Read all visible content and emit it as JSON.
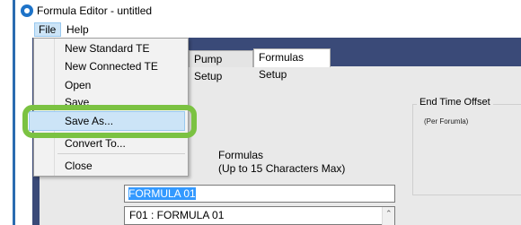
{
  "window": {
    "title": "Formula Editor - untitled"
  },
  "menubar": {
    "items": [
      {
        "label": "File"
      },
      {
        "label": "Help"
      }
    ]
  },
  "tabs": [
    {
      "label": "Pump Setup"
    },
    {
      "label": "Formulas Setup"
    }
  ],
  "file_menu": {
    "items": [
      {
        "label": "New Standard TE"
      },
      {
        "label": "New Connected TE"
      },
      {
        "label": "Open"
      },
      {
        "label": "Save"
      },
      {
        "label": "Save As..."
      },
      {
        "label": "Convert To..."
      },
      {
        "label": "Close"
      }
    ]
  },
  "end_time_offset": {
    "title": "End Time Offset",
    "note": "(Per Forumla)"
  },
  "formulas": {
    "label_line1": "Formulas",
    "label_line2": "(Up to 15 Characters Max)",
    "input_value": "FORMULA 01",
    "list_items": [
      "F01 : FORMULA 01"
    ]
  },
  "colors": {
    "accent_highlight": "#7bc242",
    "menu_hover": "#cce4f7",
    "header_band": "#3a4a78"
  },
  "icons": {
    "app": "app-logo-icon",
    "scroll_up": "chevron-up-icon"
  }
}
